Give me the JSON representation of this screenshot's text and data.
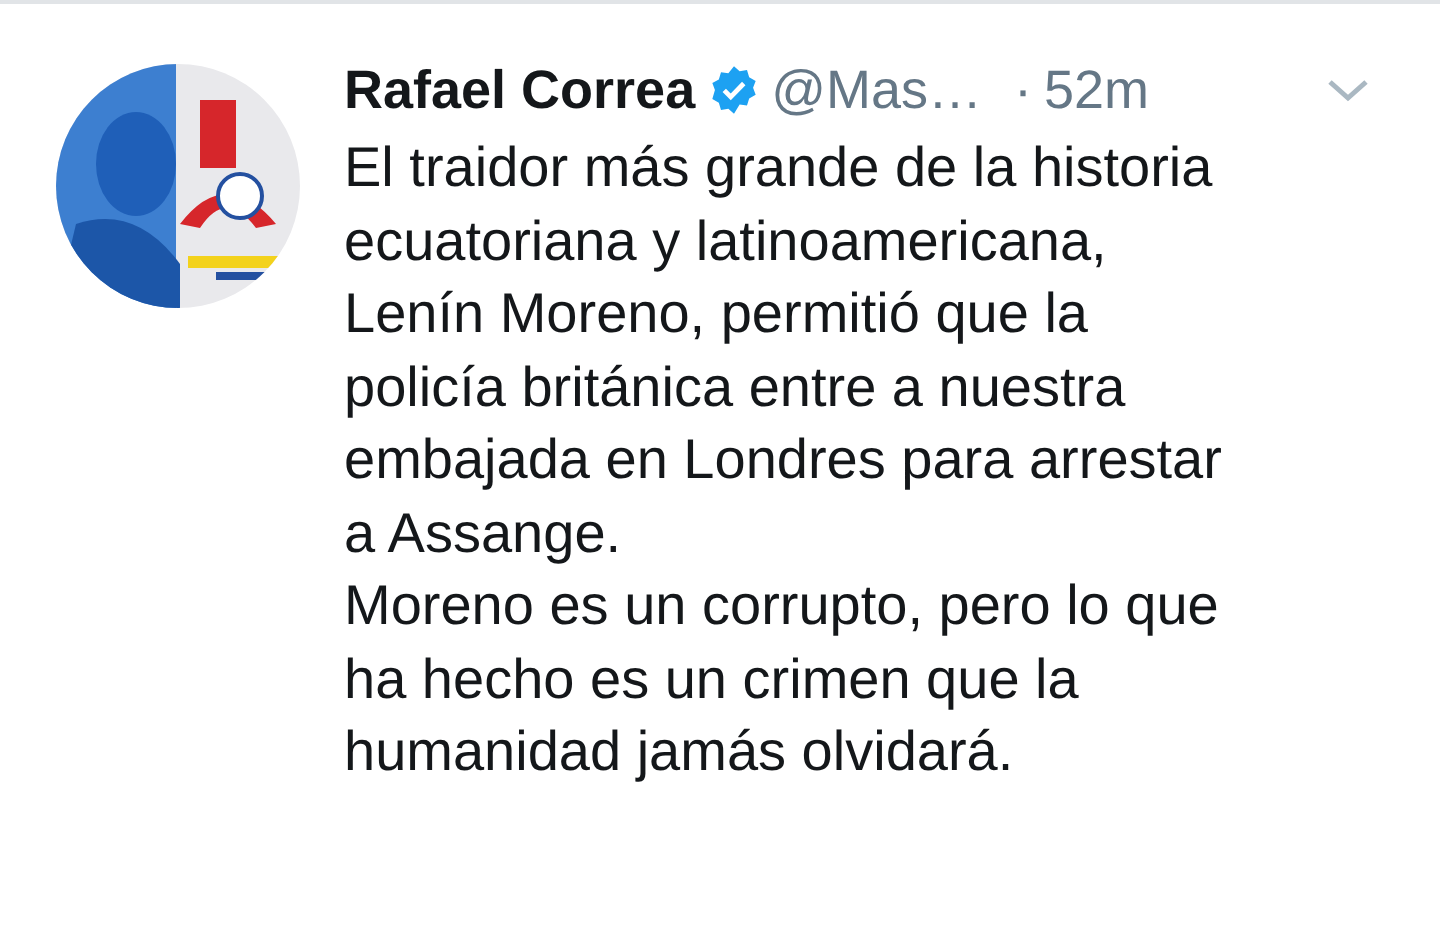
{
  "tweet": {
    "author": "Rafael Correa",
    "verified": true,
    "handle": "@Mas…",
    "separator": "·",
    "time": "52m",
    "paragraphs": [
      "El traidor más grande de la historia\necuatoriana y latinoamericana,\nLenín Moreno, permitió que la\npolicía británica entre a nuestra\nembajada en Londres para arrestar\na Assange.",
      "Moreno es un corrupto, pero lo que\nha hecho es un crimen que la\nhumanidad jamás olvidará."
    ]
  }
}
